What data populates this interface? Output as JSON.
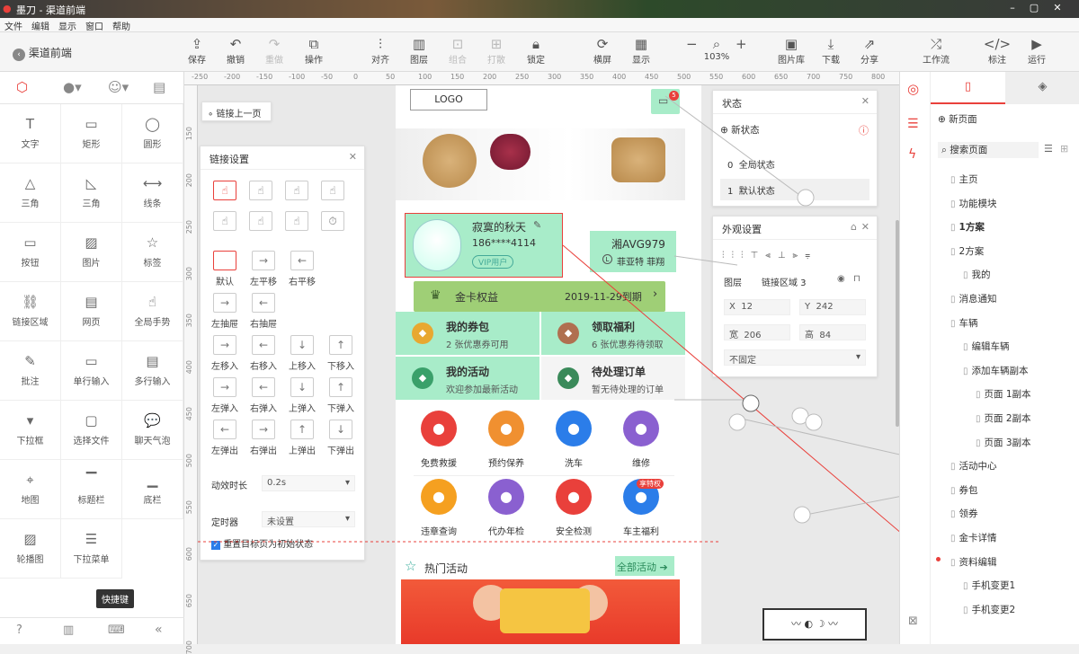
{
  "window": {
    "title": "墨刀 - 渠道前端"
  },
  "menu": [
    "文件",
    "编辑",
    "显示",
    "窗口",
    "帮助"
  ],
  "project": {
    "back_label": "渠道前端"
  },
  "toolbar": {
    "save": "保存",
    "undo": "撤销",
    "redo": "重做",
    "operate": "操作",
    "align": "对齐",
    "layer": "图层",
    "group": "组合",
    "ungroup": "打散",
    "lock": "锁定",
    "fullscreen": "横屏",
    "display": "显示",
    "zoom": "103%",
    "image_lib": "图片库",
    "download": "下载",
    "share": "分享",
    "workflow": "工作流",
    "annotate": "标注",
    "run": "运行"
  },
  "components": [
    {
      "label": "文字",
      "icon": "text-icon",
      "g": "T"
    },
    {
      "label": "矩形",
      "icon": "rectangle-icon",
      "g": "▭"
    },
    {
      "label": "圆形",
      "icon": "circle-icon",
      "g": "◯"
    },
    {
      "label": "三角",
      "icon": "triangle-icon",
      "g": "△"
    },
    {
      "label": "三角",
      "icon": "right-triangle-icon",
      "g": "◺"
    },
    {
      "label": "线条",
      "icon": "line-icon",
      "g": "⟷"
    },
    {
      "label": "按钮",
      "icon": "button-icon",
      "g": "▭"
    },
    {
      "label": "图片",
      "icon": "image-icon",
      "g": "▨"
    },
    {
      "label": "标签",
      "icon": "star-icon",
      "g": "☆"
    },
    {
      "label": "链接区域",
      "icon": "link-area-icon",
      "g": "⛓"
    },
    {
      "label": "网页",
      "icon": "webpage-icon",
      "g": "▤"
    },
    {
      "label": "全局手势",
      "icon": "gesture-icon",
      "g": "☝"
    },
    {
      "label": "批注",
      "icon": "note-icon",
      "g": "✎"
    },
    {
      "label": "单行输入",
      "icon": "single-input-icon",
      "g": "▭"
    },
    {
      "label": "多行输入",
      "icon": "multi-input-icon",
      "g": "▤"
    },
    {
      "label": "下拉框",
      "icon": "dropdown-icon",
      "g": "▾"
    },
    {
      "label": "选择文件",
      "icon": "file-icon",
      "g": "▢"
    },
    {
      "label": "聊天气泡",
      "icon": "chat-bubble-icon",
      "g": "💬"
    },
    {
      "label": "地图",
      "icon": "map-icon",
      "g": "⌖"
    },
    {
      "label": "标题栏",
      "icon": "titlebar-icon",
      "g": "▔"
    },
    {
      "label": "底栏",
      "icon": "bottombar-icon",
      "g": "▁"
    },
    {
      "label": "轮播图",
      "icon": "carousel-icon",
      "g": "▨"
    },
    {
      "label": "下拉菜单",
      "icon": "dropdown-menu-icon",
      "g": "☰"
    }
  ],
  "left_footer": {
    "tooltip": "快捷键"
  },
  "ruler_top": [
    "-250",
    "-200",
    "-150",
    "-100",
    "-50",
    "0",
    "50",
    "100",
    "150",
    "200",
    "250",
    "300",
    "350",
    "400",
    "450",
    "500",
    "550",
    "600",
    "650",
    "700",
    "750",
    "800"
  ],
  "ruler_left": [
    "150",
    "200",
    "250",
    "300",
    "350",
    "400",
    "450",
    "500",
    "550",
    "600",
    "650",
    "700"
  ],
  "prev_link": {
    "label": "链接上一页"
  },
  "link_settings": {
    "title": "链接设置",
    "anims": [
      "默认",
      "左平移",
      "右平移",
      "左抽屉",
      "右抽屉",
      "左移入",
      "右移入",
      "上移入",
      "下移入",
      "左弹入",
      "右弹入",
      "上弹入",
      "下弹入",
      "左弹出",
      "右弹出",
      "上弹出",
      "下弹出"
    ],
    "duration_label": "动效时长",
    "duration": "0.2s",
    "timer_label": "定时器",
    "timer": "未设置",
    "reset_label": "重置目标页为初始状态"
  },
  "phone": {
    "logo": "LOGO",
    "badge": "5",
    "user_name": "寂寞的秋天",
    "phone": "186****4114",
    "vip": "VIP用户",
    "plate": "湘AVG979",
    "car": "菲亚特 菲翔",
    "car_badge": "L",
    "gold_card": "金卡权益",
    "gold_expire": "2019-11-29到期",
    "quads": [
      {
        "title": "我的券包",
        "sub": "2 张优惠券可用"
      },
      {
        "title": "领取福利",
        "sub": "6 张优惠券待领取"
      },
      {
        "title": "我的活动",
        "sub": "欢迎参加最新活动"
      },
      {
        "title": "待处理订单",
        "sub": "暂无待处理的订单"
      }
    ],
    "services": [
      "免费救援",
      "预约保养",
      "洗车",
      "维修",
      "违章查询",
      "代办年检",
      "安全检测",
      "车主福利"
    ],
    "vip_tag": "享特权",
    "hot": "热门活动",
    "all": "全部活动"
  },
  "state_panel": {
    "title": "状态",
    "new": "新状态",
    "states": [
      {
        "n": "0",
        "label": "全局状态"
      },
      {
        "n": "1",
        "label": "默认状态"
      }
    ]
  },
  "appearance": {
    "title": "外观设置",
    "layer_label": "图层",
    "layer_value": "链接区域 3",
    "x": "12",
    "y": "242",
    "w": "206",
    "h": "84",
    "x_label": "X",
    "y_label": "Y",
    "w_label": "宽",
    "h_label": "高",
    "fixed": "不固定"
  },
  "pages": {
    "new": "新页面",
    "search": "搜索页面",
    "list": [
      {
        "l": "主页",
        "d": 0
      },
      {
        "l": "功能模块",
        "d": 0
      },
      {
        "l": "1方案",
        "d": 0
      },
      {
        "l": "2方案",
        "d": 0
      },
      {
        "l": "我的",
        "d": 1
      },
      {
        "l": "消息通知",
        "d": 0
      },
      {
        "l": "车辆",
        "d": 0
      },
      {
        "l": "编辑车辆",
        "d": 1
      },
      {
        "l": "添加车辆副本",
        "d": 1
      },
      {
        "l": "页面 1副本",
        "d": 2
      },
      {
        "l": "页面 2副本",
        "d": 2
      },
      {
        "l": "页面 3副本",
        "d": 2
      },
      {
        "l": "活动中心",
        "d": 0
      },
      {
        "l": "券包",
        "d": 0
      },
      {
        "l": "领券",
        "d": 0
      },
      {
        "l": "金卡详情",
        "d": 0
      },
      {
        "l": "资料编辑",
        "d": 0
      },
      {
        "l": "手机变更1",
        "d": 1
      },
      {
        "l": "手机变更2",
        "d": 1
      }
    ]
  },
  "colors": {
    "accent": "#e9403b",
    "green": "#a8ecc9",
    "gold": "#98c874"
  }
}
